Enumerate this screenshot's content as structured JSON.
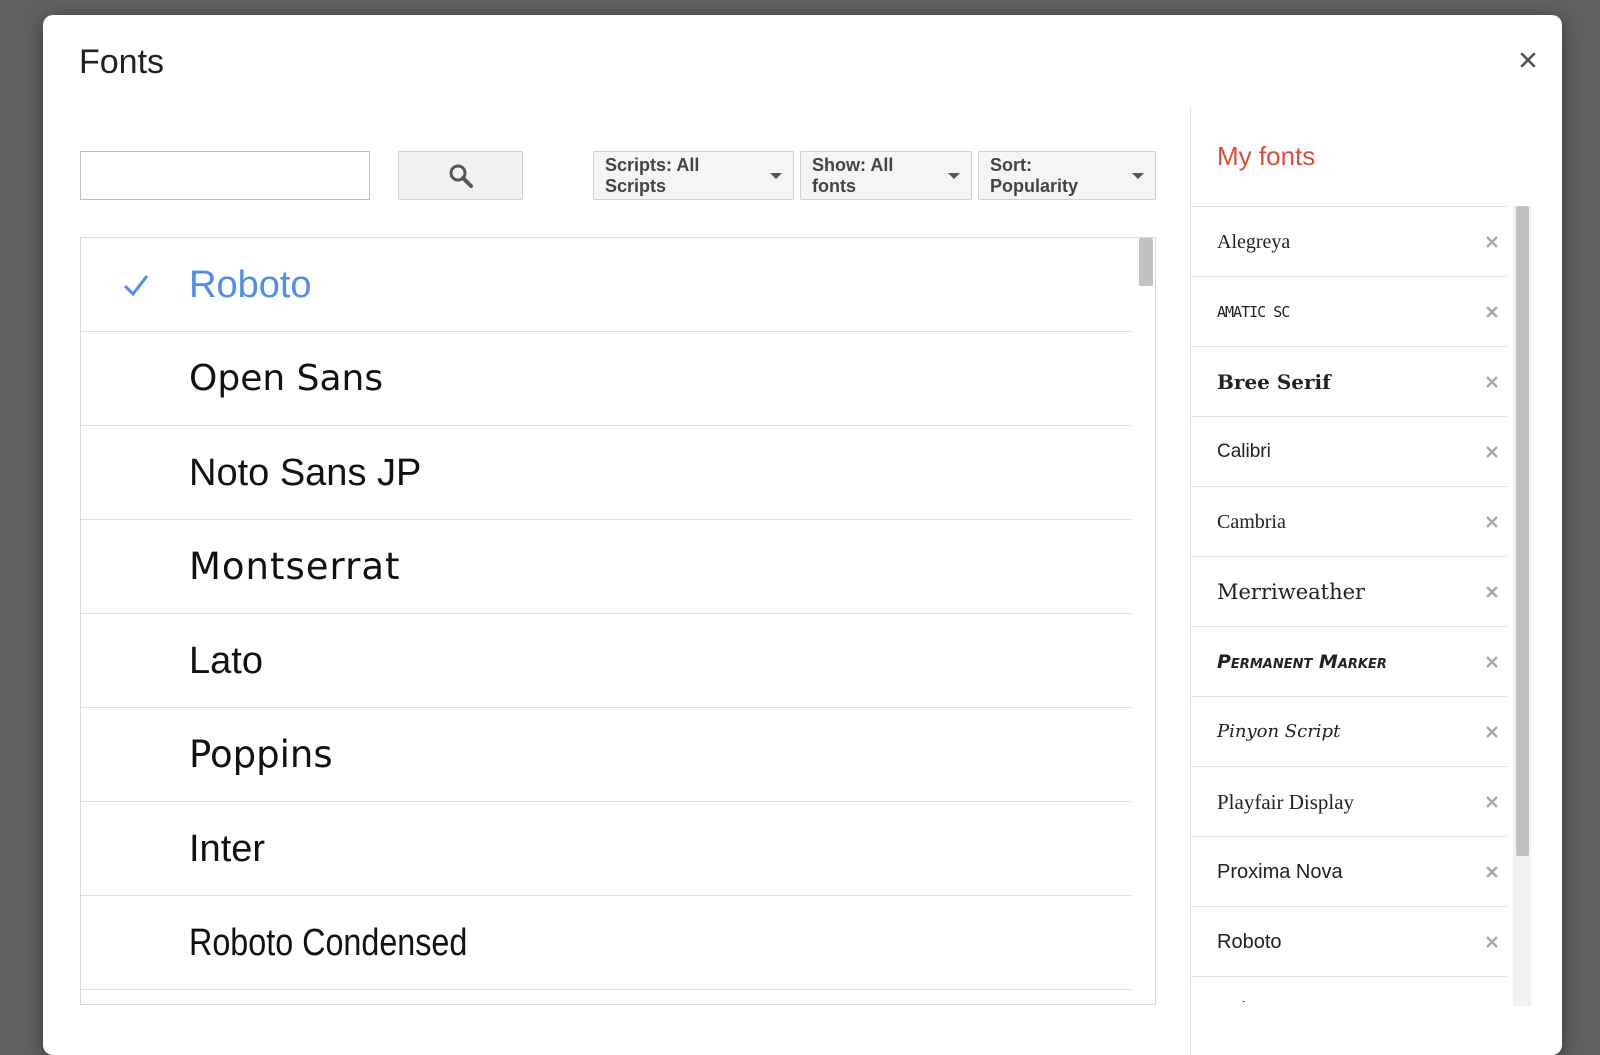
{
  "dialog": {
    "title": "Fonts",
    "close_icon": "close-icon"
  },
  "search": {
    "value": "",
    "placeholder": "",
    "button_icon": "search-icon"
  },
  "filters": {
    "scripts_label": "Scripts: All Scripts",
    "show_label": "Show: All fonts",
    "sort_label": "Sort: Popularity"
  },
  "font_list": [
    {
      "name": "Roboto",
      "selected": true
    },
    {
      "name": "Open Sans",
      "selected": false
    },
    {
      "name": "Noto Sans JP",
      "selected": false
    },
    {
      "name": "Montserrat",
      "selected": false
    },
    {
      "name": "Lato",
      "selected": false
    },
    {
      "name": "Poppins",
      "selected": false
    },
    {
      "name": "Inter",
      "selected": false
    },
    {
      "name": "Roboto Condensed",
      "selected": false
    }
  ],
  "my_fonts": {
    "title": "My fonts",
    "items": [
      {
        "name": "Alegreya"
      },
      {
        "name": "Amatic SC"
      },
      {
        "name": "Bree Serif"
      },
      {
        "name": "Calibri"
      },
      {
        "name": "Cambria"
      },
      {
        "name": "Merriweather"
      },
      {
        "name": "Permanent Marker"
      },
      {
        "name": "Pinyon Script"
      },
      {
        "name": "Playfair Display"
      },
      {
        "name": "Proxima Nova"
      },
      {
        "name": "Roboto"
      },
      {
        "name": "Roboto Mono"
      }
    ]
  },
  "colors": {
    "selected_font": "#4d8ef0",
    "my_fonts_title": "#dd4b39",
    "backdrop": "#616161"
  }
}
